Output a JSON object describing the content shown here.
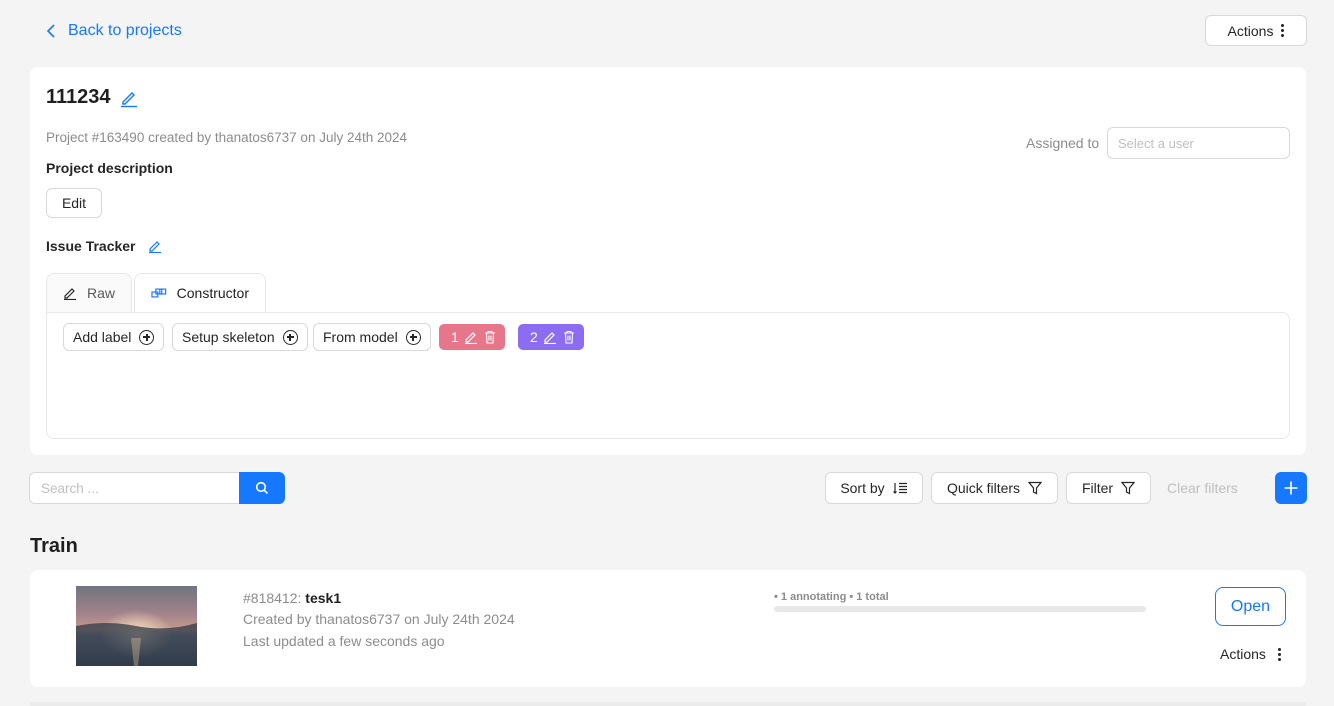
{
  "nav": {
    "back_label": "Back to projects",
    "actions_label": "Actions"
  },
  "project": {
    "title": "111234",
    "meta": "Project #163490 created by thanatos6737 on July 24th 2024",
    "description_label": "Project description",
    "edit_label": "Edit",
    "issue_tracker_label": "Issue Tracker",
    "assigned_label": "Assigned to",
    "assigned_placeholder": "Select a user"
  },
  "tabs": [
    {
      "label": "Raw",
      "icon": "pencil-icon"
    },
    {
      "label": "Constructor",
      "icon": "constructor-icon",
      "active": true
    }
  ],
  "constructor": {
    "add_label": "Add label",
    "setup_skeleton": "Setup skeleton",
    "from_model": "From model",
    "labels": [
      {
        "name": "1",
        "color": "#e8768a"
      },
      {
        "name": "2",
        "color": "#8c6cf0"
      }
    ]
  },
  "toolbar": {
    "search_placeholder": "Search ...",
    "sort_by": "Sort by",
    "quick_filters": "Quick filters",
    "filter": "Filter",
    "clear_filters": "Clear filters"
  },
  "section": {
    "title": "Train"
  },
  "task": {
    "id": "#818412:",
    "name": "tesk1",
    "created": "Created by thanatos6737 on July 24th 2024",
    "updated": "Last updated a few seconds ago",
    "progress_text": "• 1 annotating • 1 total",
    "open_label": "Open",
    "actions_label": "Actions"
  },
  "colors": {
    "accent": "#1677ff",
    "label1": "#e8768a",
    "label2": "#8c6cf0"
  }
}
